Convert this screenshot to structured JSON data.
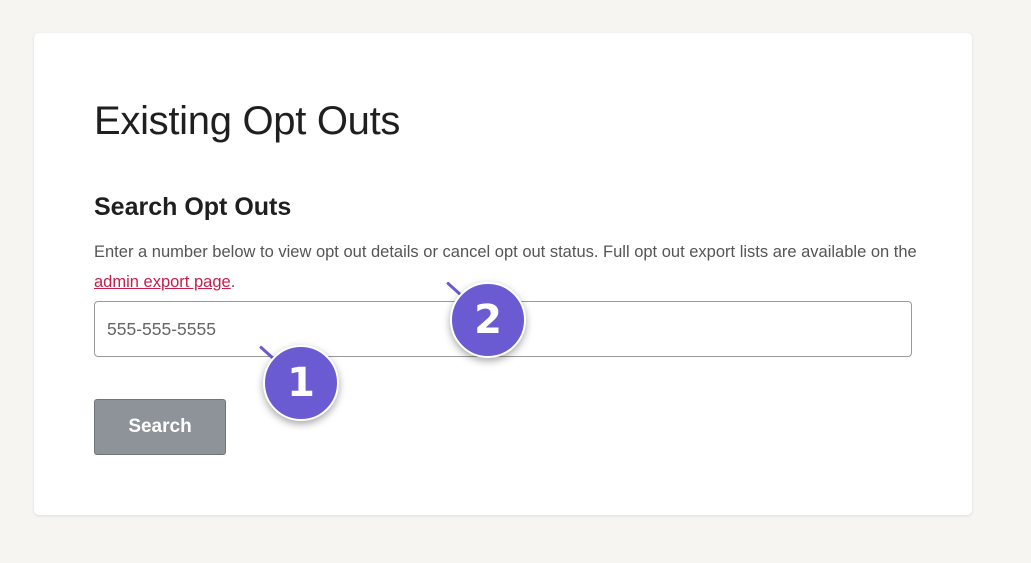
{
  "page": {
    "title": "Existing Opt Outs"
  },
  "search": {
    "heading": "Search Opt Outs",
    "description_before": "Enter a number below to view opt out details or cancel opt out status. Full opt out export lists are available on the ",
    "link_text": "admin export page",
    "description_after": ".",
    "placeholder": "555-555-5555",
    "button_label": "Search"
  },
  "markers": [
    {
      "label": "1"
    },
    {
      "label": "2"
    }
  ],
  "colors": {
    "background": "#f6f5f2",
    "link": "#c41f4a",
    "button": "#8e9399",
    "marker": "#6b5bd2"
  }
}
